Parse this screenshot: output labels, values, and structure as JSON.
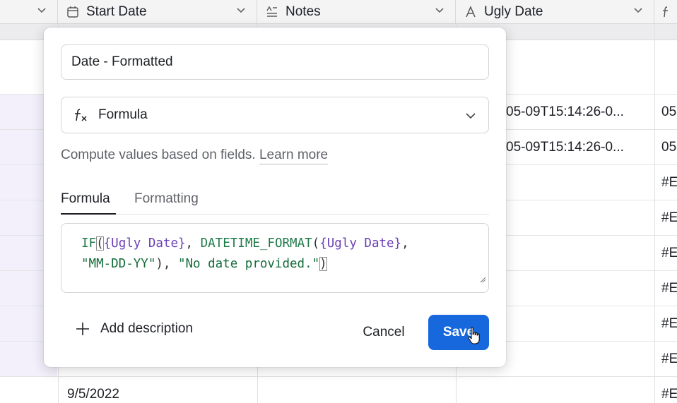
{
  "grid": {
    "columns": [
      {
        "name": "",
        "icon": "chevron-down-icon"
      },
      {
        "name": "Start Date",
        "icon": "calendar-icon"
      },
      {
        "name": "Notes",
        "icon": "long-text-icon"
      },
      {
        "name": "Ugly Date",
        "icon": "text-a-icon"
      },
      {
        "name": "",
        "icon": "formula-icon"
      }
    ],
    "ugly_date_values": [
      "05-09T15:14:26-0...",
      "05-09T15:14:26-0..."
    ],
    "last_col_values": [
      "05",
      "05",
      "#E",
      "#E",
      "#E",
      "#E",
      "#E",
      "#E",
      "#E"
    ],
    "bottom_start_date": "9/5/2022"
  },
  "modal": {
    "field_name": "Date - Formatted",
    "field_type": "Formula",
    "description": "Compute values based on fields.",
    "learn_more": "Learn more",
    "tabs": [
      "Formula",
      "Formatting"
    ],
    "active_tab": "Formula",
    "formula": {
      "if": "IF",
      "open1": "(",
      "field1": "{Ugly Date}",
      "comma1": ", ",
      "fn2": "DATETIME_FORMAT",
      "open2": "(",
      "field2": "{Ugly Date}",
      "comma2": ",",
      "str1": "\"MM-DD-YY\"",
      "close2": "), ",
      "str2": "\"No date provided.\"",
      "close1": ")"
    },
    "add_description": "Add description",
    "cancel": "Cancel",
    "save": "Save"
  },
  "colors": {
    "accent": "#1668dc",
    "formula_function": "#1f7a4a",
    "formula_field": "#6b3fb5",
    "formula_string": "#146c3a",
    "row_highlight": "#f3f0fb"
  }
}
